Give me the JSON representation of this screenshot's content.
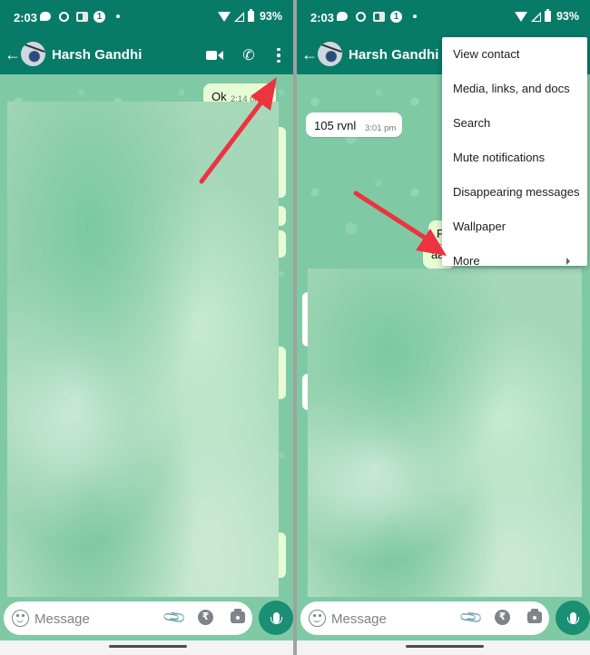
{
  "screens": [
    {
      "status": {
        "time": "2:03",
        "battery": "93%",
        "notification_count": "1"
      },
      "header": {
        "contact_name": "Harsh Gandhi"
      },
      "messages": [
        {
          "direction": "outgoing",
          "text": "Ok",
          "time": "2:14 pm"
        }
      ],
      "input": {
        "placeholder": "Message",
        "rupee_symbol": "₹"
      }
    },
    {
      "status": {
        "time": "2:03",
        "battery": "93%",
        "notification_count": "1"
      },
      "header": {
        "contact_name": "Harsh Gandhi"
      },
      "messages": [
        {
          "direction": "incoming",
          "text": "105 rvnl",
          "time": "3:01 pm"
        },
        {
          "direction": "outgoing",
          "text": "P",
          "time": ""
        },
        {
          "direction": "outgoing",
          "text": "aa",
          "time": ""
        }
      ],
      "menu": {
        "items": [
          {
            "label": "View contact"
          },
          {
            "label": "Media, links, and docs"
          },
          {
            "label": "Search"
          },
          {
            "label": "Mute notifications"
          },
          {
            "label": "Disappearing messages"
          },
          {
            "label": "Wallpaper"
          },
          {
            "label": "More",
            "has_submenu": true
          }
        ]
      },
      "input": {
        "placeholder": "Message",
        "rupee_symbol": "₹"
      }
    }
  ],
  "icons": {
    "back": "←",
    "call": "✆",
    "attach": "📎"
  },
  "colors": {
    "header": "#087b68",
    "chat_bg": "#7fcaa4",
    "outgoing_bubble": "#e7fcd5",
    "mic_button": "#1a8f73",
    "annotation_arrow": "#ec3340"
  }
}
